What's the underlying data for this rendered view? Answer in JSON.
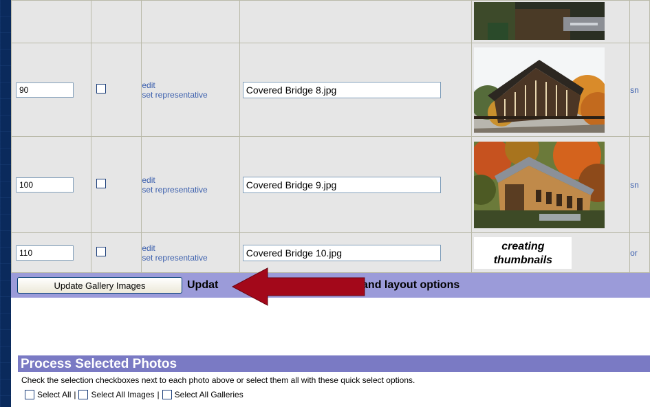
{
  "rows": [
    {
      "sort": "",
      "name": "",
      "thumb": "top",
      "cut": ""
    },
    {
      "sort": "90",
      "edit": "edit",
      "rep": "set representative",
      "name": "Covered Bridge 8.jpg",
      "thumb": "bridge8",
      "cut": "sn"
    },
    {
      "sort": "100",
      "edit": "edit",
      "rep": "set representative",
      "name": "Covered Bridge 9.jpg",
      "thumb": "bridge9",
      "cut": "sn"
    },
    {
      "sort": "110",
      "edit": "edit",
      "rep": "set representative",
      "name": "Covered Bridge 10.jpg",
      "thumb": "text",
      "thumb_text_1": "creating",
      "thumb_text_2": "thumbnails",
      "cut": "or"
    }
  ],
  "update": {
    "button": "Update Gallery Images",
    "text_left": "Updat",
    "text_right": "bers, and layout options"
  },
  "process": {
    "title": "Process Selected Photos",
    "description": "Check the selection checkboxes next to each photo above or select them all with these quick select options.",
    "select_all": "Select All",
    "select_all_images": "Select All Images",
    "select_all_galleries": "Select All Galleries",
    "separator": "|"
  },
  "colors": {
    "update_bar": "#9b9bd9",
    "process_header": "#7a7ac4",
    "arrow": "#a3081a"
  }
}
